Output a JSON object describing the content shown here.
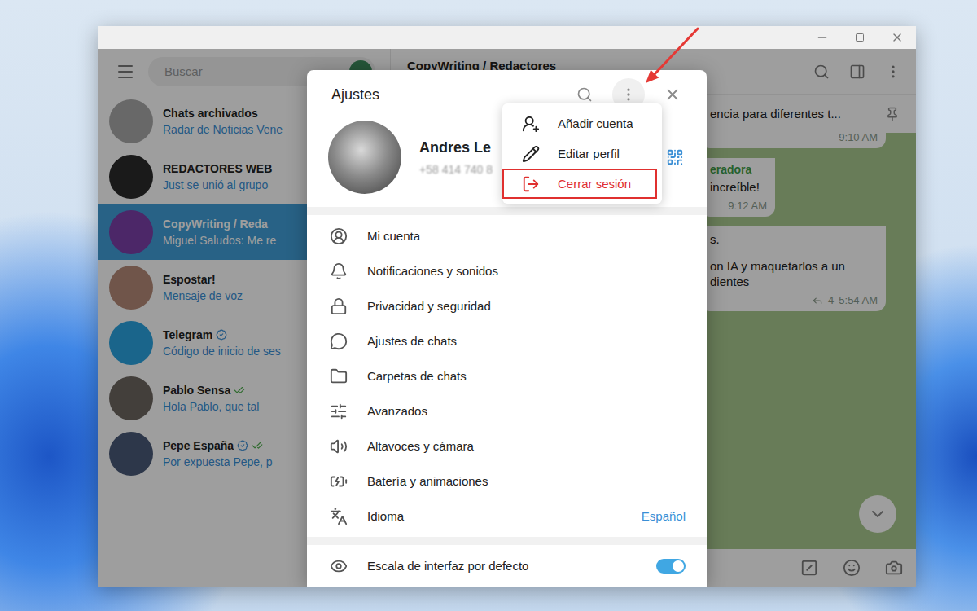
{
  "sidebar": {
    "search_placeholder": "Buscar",
    "chats": [
      {
        "name": "Chats archivados",
        "preview": "Radar de Noticias Vene",
        "selected": false,
        "verified": false,
        "read": false,
        "color": "#a9a9a9"
      },
      {
        "name": "REDACTORES WEB",
        "preview": "Just se unió al grupo",
        "selected": false,
        "verified": false,
        "read": false,
        "color": "#2b2b2b"
      },
      {
        "name": "CopyWriting / Reda",
        "preview": "Miguel Saludos: Me re",
        "selected": true,
        "verified": false,
        "read": false,
        "color": "#7b3fa8"
      },
      {
        "name": "Espostar!",
        "preview": "Mensaje de voz",
        "selected": false,
        "verified": false,
        "read": false,
        "color": "#b58a78"
      },
      {
        "name": "Telegram",
        "preview": "Código de inicio de ses",
        "selected": false,
        "verified": true,
        "read": false,
        "color": "#2aa3e0"
      },
      {
        "name": "Pablo Sensa",
        "preview": "Hola Pablo, que tal",
        "selected": false,
        "verified": false,
        "read": true,
        "color": "#6d6660"
      },
      {
        "name": "Pepe España",
        "preview": "Por expuesta Pepe, p",
        "selected": false,
        "verified": true,
        "read": true,
        "color": "#4a5a78"
      }
    ]
  },
  "chat": {
    "title": "CopyWriting / Redactores",
    "pinned": {
      "text": "encia para diferentes t..."
    },
    "messages": [
      {
        "author": "",
        "paragraphs": [],
        "time": "9:10 AM",
        "replies": ""
      },
      {
        "author": "eradora",
        "paragraphs": [
          [
            "increíble!"
          ]
        ],
        "time": "9:12 AM",
        "replies": ""
      },
      {
        "author": "",
        "paragraphs": [
          [
            "s."
          ],
          [
            "on IA y maquetarlos a un",
            "dientes"
          ]
        ],
        "time": "5:54 AM",
        "replies": "4"
      }
    ]
  },
  "settings": {
    "title": "Ajustes",
    "profile": {
      "name": "Andres Le",
      "phone": "+58 414 740 8"
    },
    "items": [
      {
        "label": "Mi cuenta",
        "value": ""
      },
      {
        "label": "Notificaciones y sonidos",
        "value": ""
      },
      {
        "label": "Privacidad y seguridad",
        "value": ""
      },
      {
        "label": "Ajustes de chats",
        "value": ""
      },
      {
        "label": "Carpetas de chats",
        "value": ""
      },
      {
        "label": "Avanzados",
        "value": ""
      },
      {
        "label": "Altavoces y cámara",
        "value": ""
      },
      {
        "label": "Batería y animaciones",
        "value": ""
      },
      {
        "label": "Idioma",
        "value": "Español"
      }
    ],
    "toggle": {
      "label": "Escala de interfaz por defecto",
      "on": true
    }
  },
  "menu": {
    "items": [
      {
        "label": "Añadir cuenta",
        "danger": false,
        "highlighted": false
      },
      {
        "label": "Editar perfil",
        "danger": false,
        "highlighted": false
      },
      {
        "label": "Cerrar sesión",
        "danger": true,
        "highlighted": true
      }
    ]
  }
}
